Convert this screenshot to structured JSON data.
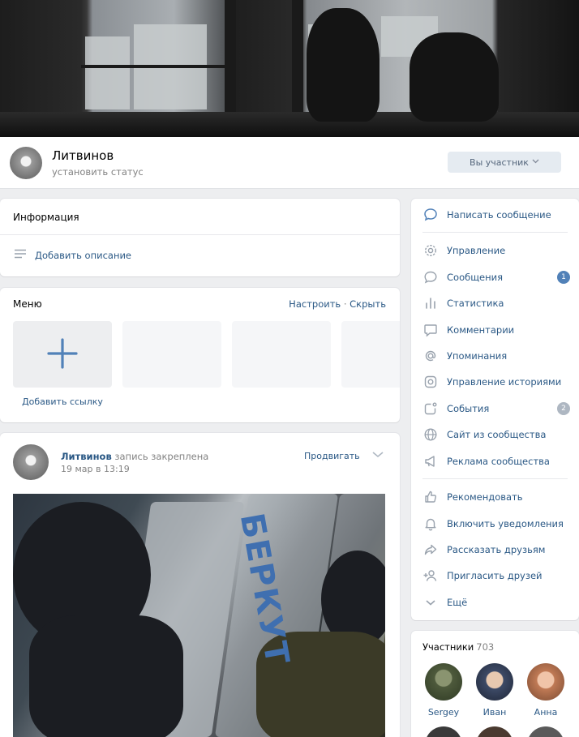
{
  "group": {
    "name": "Литвинов",
    "status": "установить статус",
    "member_button": "Вы участник"
  },
  "info": {
    "title": "Информация",
    "add_description": "Добавить описание"
  },
  "menu": {
    "title": "Меню",
    "configure": "Настроить",
    "separator": "·",
    "hide": "Скрыть",
    "add_link": "Добавить ссылку"
  },
  "post": {
    "author": "Литвинов",
    "pinned_text": "запись закреплена",
    "date": "19 мар в 13:19",
    "promote": "Продвигать",
    "photo_text": "БЕРКУТ"
  },
  "sidebar": {
    "items": [
      {
        "label": "Написать сообщение",
        "icon": "message-bubble-icon"
      },
      {
        "label": "Управление",
        "icon": "gear-icon"
      },
      {
        "label": "Сообщения",
        "icon": "chat-bubble-icon",
        "badge": "1",
        "badge_color": "#5181b8"
      },
      {
        "label": "Статистика",
        "icon": "bar-chart-icon"
      },
      {
        "label": "Комментарии",
        "icon": "comment-icon"
      },
      {
        "label": "Упоминания",
        "icon": "at-sign-icon"
      },
      {
        "label": "Управление историями",
        "icon": "stories-icon"
      },
      {
        "label": "События",
        "icon": "event-icon",
        "badge": "2",
        "badge_color": "#aeb7c2"
      },
      {
        "label": "Сайт из сообщества",
        "icon": "globe-icon"
      },
      {
        "label": "Реклама сообщества",
        "icon": "megaphone-icon"
      },
      {
        "label": "Рекомендовать",
        "icon": "thumbs-up-icon"
      },
      {
        "label": "Включить уведомления",
        "icon": "bell-icon"
      },
      {
        "label": "Рассказать друзьям",
        "icon": "share-arrow-icon"
      },
      {
        "label": "Пригласить друзей",
        "icon": "add-user-icon"
      },
      {
        "label": "Ещё",
        "icon": "chevron-down-icon"
      }
    ]
  },
  "members": {
    "title": "Участники",
    "count": "703",
    "list": [
      {
        "name": "Sergey",
        "color": "#4e5a3c"
      },
      {
        "name": "Иван",
        "color": "#3d4a66"
      },
      {
        "name": "Анна",
        "color": "#c07a55"
      }
    ]
  },
  "colors": {
    "link": "#2a5885",
    "accent": "#5181b8",
    "background": "#edeef0"
  }
}
